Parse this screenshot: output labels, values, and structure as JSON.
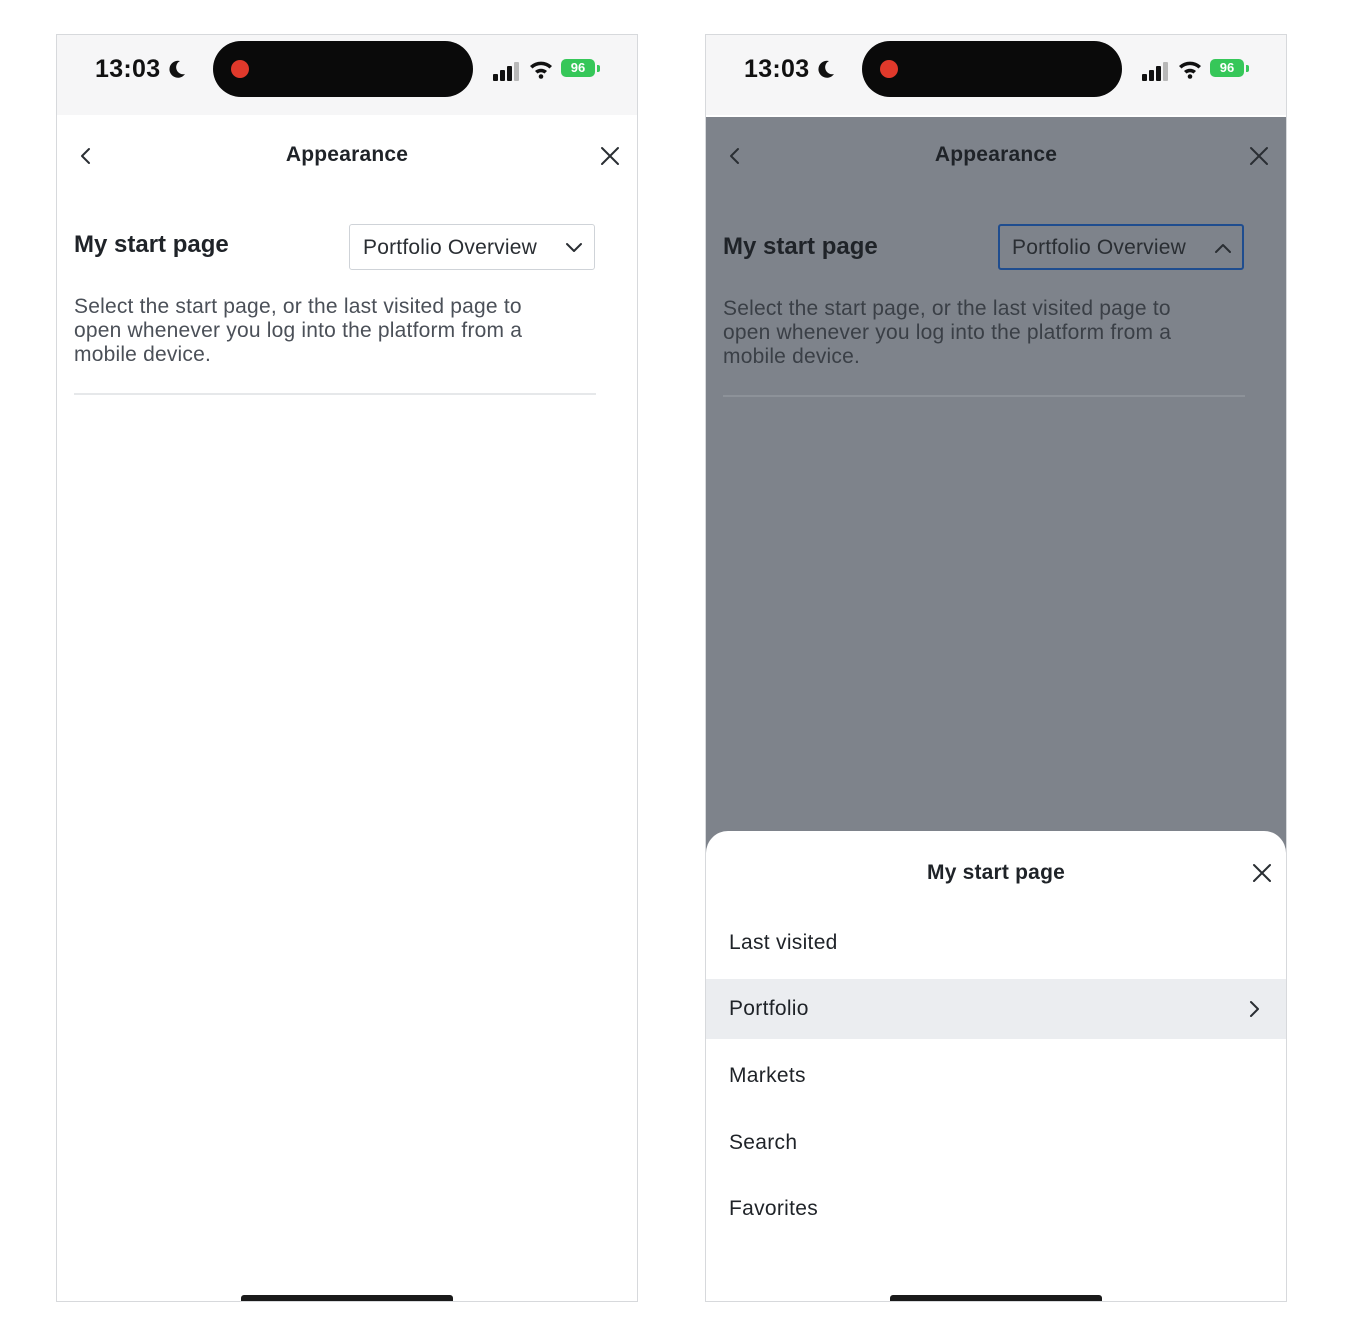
{
  "status_bar": {
    "time": "13:03",
    "battery": "96"
  },
  "screen_left": {
    "nav": {
      "title": "Appearance"
    },
    "setting": {
      "label": "My start page",
      "selected_value": "Portfolio Overview",
      "description": "Select the start page, or the last visited page to open whenever you log into the platform from a mobile device."
    }
  },
  "screen_right": {
    "nav": {
      "title": "Appearance"
    },
    "setting": {
      "label": "My start page",
      "selected_value": "Portfolio Overview",
      "description": "Select the start page, or the last visited page to open whenever you log into the platform from a mobile device."
    },
    "sheet": {
      "title": "My start page",
      "options": [
        {
          "label": "Last visited"
        },
        {
          "label": "Portfolio"
        },
        {
          "label": "Markets"
        },
        {
          "label": "Search"
        },
        {
          "label": "Favorites"
        }
      ]
    }
  },
  "icons": {
    "back": "chevron-left-icon",
    "close": "close-icon",
    "dropdown_closed": "chevron-down-icon",
    "dropdown_open": "chevron-up-icon",
    "submenu": "chevron-right-icon"
  },
  "colors": {
    "overlay": "#7e838b",
    "focus_border": "#1f4d8f",
    "battery": "#36c759",
    "recording": "#e0392b",
    "highlight_row": "#ebedf0"
  }
}
